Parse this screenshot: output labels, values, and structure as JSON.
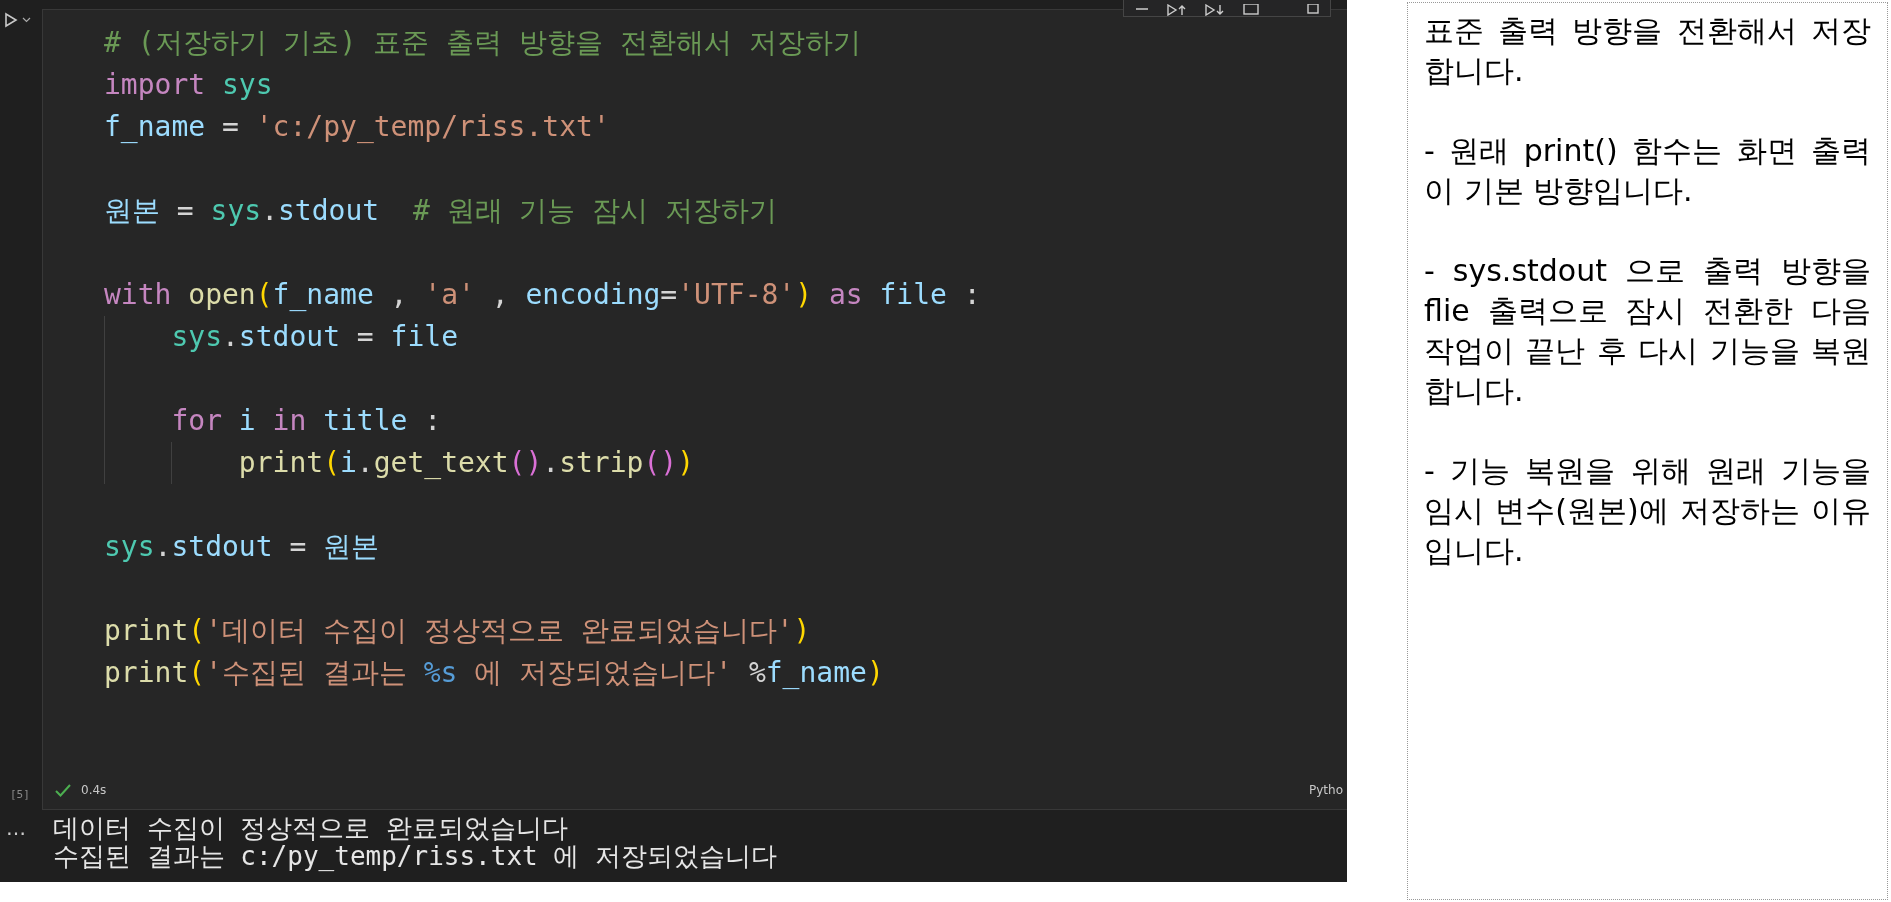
{
  "cell": {
    "execution_count": "[5]",
    "status": "0.4s",
    "succeeded": true,
    "language": "Pytho",
    "lines": [
      {
        "kind": "code",
        "tokens": [
          {
            "kind": "comment",
            "text": "# (저장하기 기초) 표준 출력 방향을 전환해서 저장하기"
          }
        ]
      },
      {
        "kind": "code",
        "tokens": [
          {
            "kind": "keyword",
            "text": "import"
          },
          {
            "kind": "module",
            "text": " sys"
          }
        ]
      },
      {
        "kind": "code",
        "tokens": [
          {
            "kind": "variable",
            "text": "f_name"
          },
          {
            "kind": "plain",
            "text": " = "
          },
          {
            "kind": "string",
            "text": "'c:/py_temp/riss.txt'"
          }
        ]
      },
      {
        "kind": "blank"
      },
      {
        "kind": "code",
        "tokens": [
          {
            "kind": "variable",
            "text": "원본"
          },
          {
            "kind": "plain",
            "text": " = "
          },
          {
            "kind": "module",
            "text": "sys"
          },
          {
            "kind": "plain",
            "text": "."
          },
          {
            "kind": "variable",
            "text": "stdout"
          },
          {
            "kind": "comment",
            "text": "  # 원래 기능 잠시 저장하기"
          }
        ]
      },
      {
        "kind": "blank"
      },
      {
        "kind": "code",
        "tokens": [
          {
            "kind": "keyword",
            "text": "with"
          },
          {
            "kind": "function",
            "text": " open"
          },
          {
            "kind": "bracket",
            "text": "("
          },
          {
            "kind": "variable",
            "text": "f_name"
          },
          {
            "kind": "plain",
            "text": " , "
          },
          {
            "kind": "string",
            "text": "'a'"
          },
          {
            "kind": "plain",
            "text": " , "
          },
          {
            "kind": "variable",
            "text": "encoding"
          },
          {
            "kind": "plain",
            "text": "="
          },
          {
            "kind": "string",
            "text": "'UTF-8'"
          },
          {
            "kind": "bracket",
            "text": ")"
          },
          {
            "kind": "keyword",
            "text": " as"
          },
          {
            "kind": "variable",
            "text": " file"
          },
          {
            "kind": "plain",
            "text": " :"
          }
        ],
        "children": [
          {
            "kind": "code",
            "tokens": [
              {
                "kind": "module",
                "text": "sys"
              },
              {
                "kind": "plain",
                "text": "."
              },
              {
                "kind": "variable",
                "text": "stdout"
              },
              {
                "kind": "plain",
                "text": " = "
              },
              {
                "kind": "variable",
                "text": "file"
              }
            ]
          },
          {
            "kind": "blank"
          },
          {
            "kind": "code",
            "tokens": [
              {
                "kind": "keyword",
                "text": "for"
              },
              {
                "kind": "variable",
                "text": " i"
              },
              {
                "kind": "keyword",
                "text": " in"
              },
              {
                "kind": "variable",
                "text": " title"
              },
              {
                "kind": "plain",
                "text": " :"
              }
            ],
            "children": [
              {
                "kind": "code",
                "tokens": [
                  {
                    "kind": "function",
                    "text": "print"
                  },
                  {
                    "kind": "bracket",
                    "text": "("
                  },
                  {
                    "kind": "variable",
                    "text": "i"
                  },
                  {
                    "kind": "plain",
                    "text": "."
                  },
                  {
                    "kind": "function",
                    "text": "get_text"
                  },
                  {
                    "kind": "bracket2",
                    "text": "()"
                  },
                  {
                    "kind": "plain",
                    "text": "."
                  },
                  {
                    "kind": "function",
                    "text": "strip"
                  },
                  {
                    "kind": "bracket2",
                    "text": "()"
                  },
                  {
                    "kind": "bracket",
                    "text": ")"
                  }
                ]
              }
            ]
          }
        ]
      },
      {
        "kind": "blank"
      },
      {
        "kind": "code",
        "tokens": [
          {
            "kind": "module",
            "text": "sys"
          },
          {
            "kind": "plain",
            "text": "."
          },
          {
            "kind": "variable",
            "text": "stdout"
          },
          {
            "kind": "plain",
            "text": " = "
          },
          {
            "kind": "variable",
            "text": "원본"
          }
        ]
      },
      {
        "kind": "blank"
      },
      {
        "kind": "code",
        "tokens": [
          {
            "kind": "function",
            "text": "print"
          },
          {
            "kind": "bracket",
            "text": "("
          },
          {
            "kind": "string",
            "text": "'데이터 수집이 정상적으로 완료되었습니다'"
          },
          {
            "kind": "bracket",
            "text": ")"
          }
        ]
      },
      {
        "kind": "code",
        "tokens": [
          {
            "kind": "function",
            "text": "print"
          },
          {
            "kind": "bracket",
            "text": "("
          },
          {
            "kind": "string",
            "text": "'수집된 결과는 "
          },
          {
            "kind": "format",
            "text": "%s"
          },
          {
            "kind": "string",
            "text": " 에 저장되었습니다'"
          },
          {
            "kind": "plain",
            "text": " %"
          },
          {
            "kind": "variable",
            "text": "f_name"
          },
          {
            "kind": "bracket",
            "text": ")"
          }
        ]
      }
    ]
  },
  "output": {
    "marker": "…",
    "lines": [
      "데이터 수집이 정상적으로 완료되었습니다",
      "수집된 결과는 c:/py_temp/riss.txt 에 저장되었습니다"
    ]
  },
  "notes": [
    "표준 출력 방향을 전환해서 저장합니다.",
    "- 원래 print() 함수는 화면 출력이 기본 방향입니다.",
    "- sys.stdout 으로 출력 방향을 flie 출력으로 잠시 전환한 다음 작업이 끝난 후 다시 기능을 복원합니다.",
    "- 기능 복원을 위해 원래 기능을 임시 변수(원본)에 저장하는 이유 입니다."
  ]
}
